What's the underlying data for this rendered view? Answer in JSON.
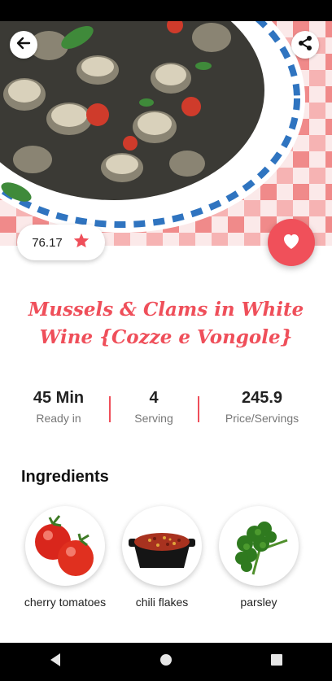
{
  "recipe": {
    "title": "Mussels & Clams in White Wine {Cozze e Vongole}",
    "rating": "76.17"
  },
  "stats": [
    {
      "value": "45 Min",
      "label": "Ready in"
    },
    {
      "value": "4",
      "label": "Serving"
    },
    {
      "value": "245.9",
      "label": "Price/Servings"
    }
  ],
  "ingredients": {
    "heading": "Ingredients",
    "items": [
      {
        "name": "cherry tomatoes"
      },
      {
        "name": "chili flakes"
      },
      {
        "name": "parsley"
      }
    ]
  },
  "icons": {
    "back": "arrow-left-icon",
    "share": "share-icon",
    "star": "star-icon",
    "favorite": "heart-icon"
  },
  "colors": {
    "accent": "#ef4f5a",
    "status_bar": "#000000"
  }
}
